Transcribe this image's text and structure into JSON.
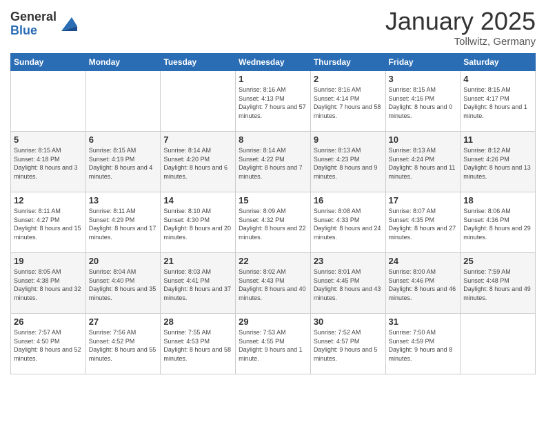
{
  "header": {
    "logo_general": "General",
    "logo_blue": "Blue",
    "month_title": "January 2025",
    "location": "Tollwitz, Germany"
  },
  "weekdays": [
    "Sunday",
    "Monday",
    "Tuesday",
    "Wednesday",
    "Thursday",
    "Friday",
    "Saturday"
  ],
  "weeks": [
    [
      {
        "day": "",
        "info": ""
      },
      {
        "day": "",
        "info": ""
      },
      {
        "day": "",
        "info": ""
      },
      {
        "day": "1",
        "info": "Sunrise: 8:16 AM\nSunset: 4:13 PM\nDaylight: 7 hours\nand 57 minutes."
      },
      {
        "day": "2",
        "info": "Sunrise: 8:16 AM\nSunset: 4:14 PM\nDaylight: 7 hours\nand 58 minutes."
      },
      {
        "day": "3",
        "info": "Sunrise: 8:15 AM\nSunset: 4:16 PM\nDaylight: 8 hours\nand 0 minutes."
      },
      {
        "day": "4",
        "info": "Sunrise: 8:15 AM\nSunset: 4:17 PM\nDaylight: 8 hours\nand 1 minute."
      }
    ],
    [
      {
        "day": "5",
        "info": "Sunrise: 8:15 AM\nSunset: 4:18 PM\nDaylight: 8 hours\nand 3 minutes."
      },
      {
        "day": "6",
        "info": "Sunrise: 8:15 AM\nSunset: 4:19 PM\nDaylight: 8 hours\nand 4 minutes."
      },
      {
        "day": "7",
        "info": "Sunrise: 8:14 AM\nSunset: 4:20 PM\nDaylight: 8 hours\nand 6 minutes."
      },
      {
        "day": "8",
        "info": "Sunrise: 8:14 AM\nSunset: 4:22 PM\nDaylight: 8 hours\nand 7 minutes."
      },
      {
        "day": "9",
        "info": "Sunrise: 8:13 AM\nSunset: 4:23 PM\nDaylight: 8 hours\nand 9 minutes."
      },
      {
        "day": "10",
        "info": "Sunrise: 8:13 AM\nSunset: 4:24 PM\nDaylight: 8 hours\nand 11 minutes."
      },
      {
        "day": "11",
        "info": "Sunrise: 8:12 AM\nSunset: 4:26 PM\nDaylight: 8 hours\nand 13 minutes."
      }
    ],
    [
      {
        "day": "12",
        "info": "Sunrise: 8:11 AM\nSunset: 4:27 PM\nDaylight: 8 hours\nand 15 minutes."
      },
      {
        "day": "13",
        "info": "Sunrise: 8:11 AM\nSunset: 4:29 PM\nDaylight: 8 hours\nand 17 minutes."
      },
      {
        "day": "14",
        "info": "Sunrise: 8:10 AM\nSunset: 4:30 PM\nDaylight: 8 hours\nand 20 minutes."
      },
      {
        "day": "15",
        "info": "Sunrise: 8:09 AM\nSunset: 4:32 PM\nDaylight: 8 hours\nand 22 minutes."
      },
      {
        "day": "16",
        "info": "Sunrise: 8:08 AM\nSunset: 4:33 PM\nDaylight: 8 hours\nand 24 minutes."
      },
      {
        "day": "17",
        "info": "Sunrise: 8:07 AM\nSunset: 4:35 PM\nDaylight: 8 hours\nand 27 minutes."
      },
      {
        "day": "18",
        "info": "Sunrise: 8:06 AM\nSunset: 4:36 PM\nDaylight: 8 hours\nand 29 minutes."
      }
    ],
    [
      {
        "day": "19",
        "info": "Sunrise: 8:05 AM\nSunset: 4:38 PM\nDaylight: 8 hours\nand 32 minutes."
      },
      {
        "day": "20",
        "info": "Sunrise: 8:04 AM\nSunset: 4:40 PM\nDaylight: 8 hours\nand 35 minutes."
      },
      {
        "day": "21",
        "info": "Sunrise: 8:03 AM\nSunset: 4:41 PM\nDaylight: 8 hours\nand 37 minutes."
      },
      {
        "day": "22",
        "info": "Sunrise: 8:02 AM\nSunset: 4:43 PM\nDaylight: 8 hours\nand 40 minutes."
      },
      {
        "day": "23",
        "info": "Sunrise: 8:01 AM\nSunset: 4:45 PM\nDaylight: 8 hours\nand 43 minutes."
      },
      {
        "day": "24",
        "info": "Sunrise: 8:00 AM\nSunset: 4:46 PM\nDaylight: 8 hours\nand 46 minutes."
      },
      {
        "day": "25",
        "info": "Sunrise: 7:59 AM\nSunset: 4:48 PM\nDaylight: 8 hours\nand 49 minutes."
      }
    ],
    [
      {
        "day": "26",
        "info": "Sunrise: 7:57 AM\nSunset: 4:50 PM\nDaylight: 8 hours\nand 52 minutes."
      },
      {
        "day": "27",
        "info": "Sunrise: 7:56 AM\nSunset: 4:52 PM\nDaylight: 8 hours\nand 55 minutes."
      },
      {
        "day": "28",
        "info": "Sunrise: 7:55 AM\nSunset: 4:53 PM\nDaylight: 8 hours\nand 58 minutes."
      },
      {
        "day": "29",
        "info": "Sunrise: 7:53 AM\nSunset: 4:55 PM\nDaylight: 9 hours\nand 1 minute."
      },
      {
        "day": "30",
        "info": "Sunrise: 7:52 AM\nSunset: 4:57 PM\nDaylight: 9 hours\nand 5 minutes."
      },
      {
        "day": "31",
        "info": "Sunrise: 7:50 AM\nSunset: 4:59 PM\nDaylight: 9 hours\nand 8 minutes."
      },
      {
        "day": "",
        "info": ""
      }
    ]
  ]
}
